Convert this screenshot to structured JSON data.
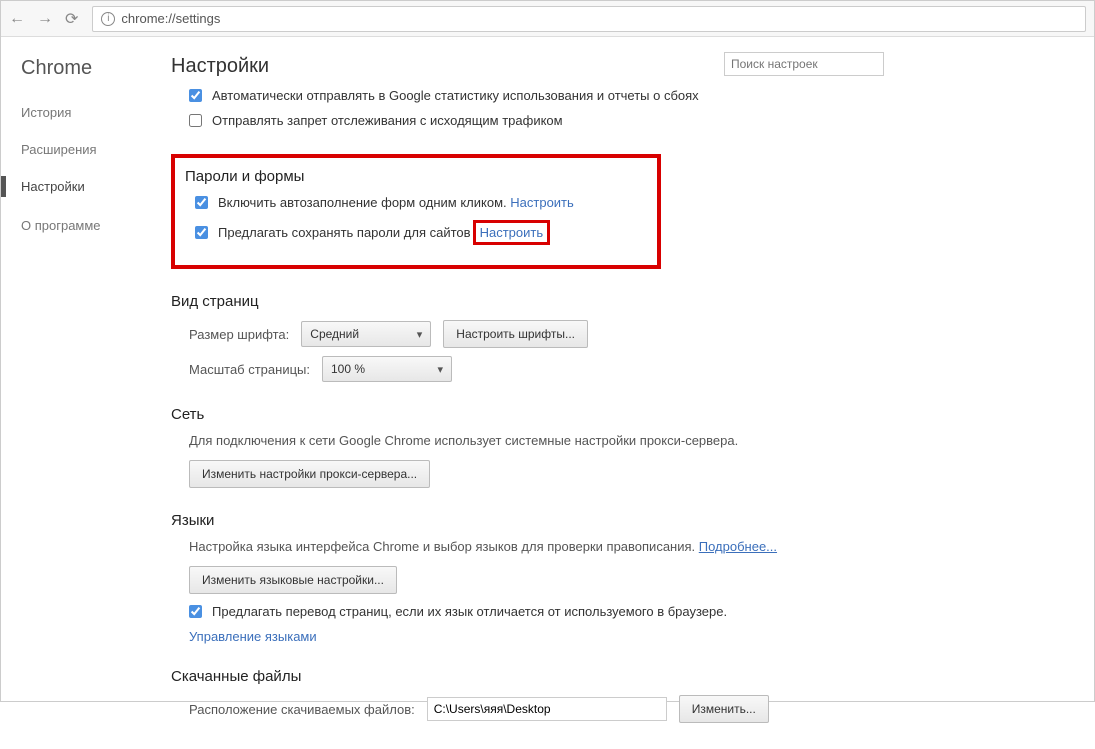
{
  "url": "chrome://settings",
  "sidebar": {
    "brand": "Chrome",
    "items": [
      "История",
      "Расширения",
      "Настройки"
    ],
    "about": "О программе"
  },
  "pageTitle": "Настройки",
  "searchPlaceholder": "Поиск настроек",
  "topChecks": {
    "autoStats": {
      "checked": true,
      "label": "Автоматически отправлять в Google статистику использования и отчеты о сбоях"
    },
    "dnt": {
      "checked": false,
      "label": "Отправлять запрет отслеживания с исходящим трафиком"
    }
  },
  "passwords": {
    "title": "Пароли и формы",
    "autofill": {
      "checked": true,
      "label": "Включить автозаполнение форм одним кликом.",
      "linkText": "Настроить"
    },
    "savePw": {
      "checked": true,
      "label": "Предлагать сохранять пароли для сайтов",
      "linkText": "Настроить"
    }
  },
  "pageView": {
    "title": "Вид страниц",
    "fontLabel": "Размер шрифта:",
    "fontValue": "Средний",
    "fontBtn": "Настроить шрифты...",
    "zoomLabel": "Масштаб страницы:",
    "zoomValue": "100 %"
  },
  "network": {
    "title": "Сеть",
    "desc": "Для подключения к сети Google Chrome использует системные настройки прокси-сервера.",
    "btn": "Изменить настройки прокси-сервера..."
  },
  "languages": {
    "title": "Языки",
    "desc": "Настройка языка интерфейса Chrome и выбор языков для проверки правописания.",
    "moreLink": "Подробнее...",
    "btn": "Изменить языковые настройки...",
    "translate": {
      "checked": true,
      "label": "Предлагать перевод страниц, если их язык отличается от используемого в браузере."
    },
    "manage": "Управление языками"
  },
  "downloads": {
    "title": "Скачанные файлы",
    "locLabel": "Расположение скачиваемых файлов:",
    "path": "C:\\Users\\яяя\\Desktop",
    "changeBtn": "Изменить..."
  }
}
